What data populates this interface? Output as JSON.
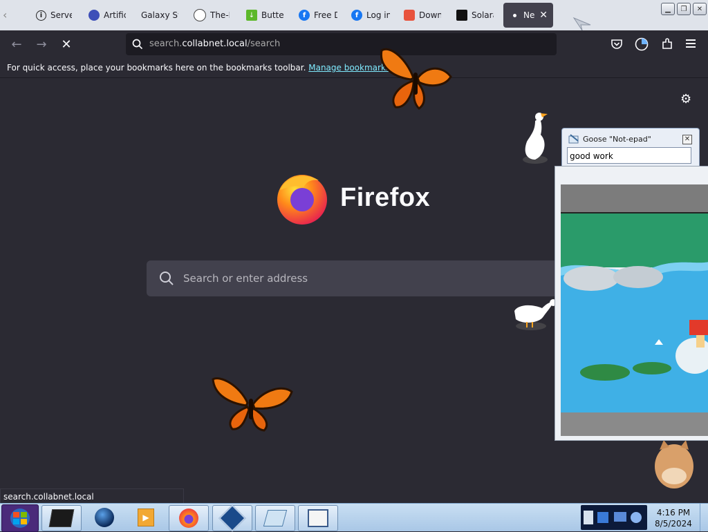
{
  "tabs": [
    {
      "label": "Server",
      "icon": "info-icon"
    },
    {
      "label": "Artific",
      "icon": "globe-icon"
    },
    {
      "label": "Galaxy Sw",
      "icon": ""
    },
    {
      "label": "The-M",
      "icon": "github-icon"
    },
    {
      "label": "Butter",
      "icon": "download-icon"
    },
    {
      "label": "Free D",
      "icon": "facebook-icon"
    },
    {
      "label": "Log in",
      "icon": "facebook-icon"
    },
    {
      "label": "Down",
      "icon": "store-icon"
    },
    {
      "label": "Solara",
      "icon": "solara-icon"
    },
    {
      "label": "Ne",
      "icon": "dot-icon",
      "active": true
    }
  ],
  "url": {
    "prefix": "search.",
    "domain": "collabnet.local",
    "path": "/search"
  },
  "bookmarks": {
    "message": "For quick access, place your bookmarks here on the bookmarks toolbar.",
    "link": "Manage bookmarks..."
  },
  "newtab": {
    "brand": "Firefox",
    "search_placeholder": "Search or enter address"
  },
  "notepad": {
    "title": "Goose \"Not-epad\"",
    "text": "good work"
  },
  "status": {
    "text": "search.collabnet.local"
  },
  "clock": {
    "time": "4:16 PM",
    "date": "8/5/2024"
  },
  "colors": {
    "accent_link": "#80ebff",
    "toolbar_bg": "#2b2a33",
    "tabstrip_bg": "#dfe3ea"
  }
}
